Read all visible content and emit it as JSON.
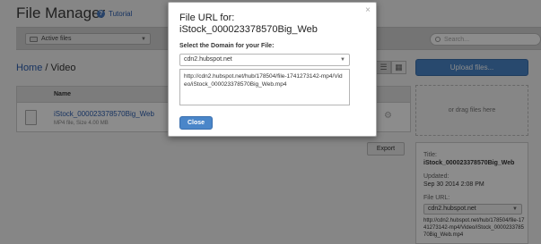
{
  "header": {
    "title": "File Manager",
    "tutorial_label": "Tutorial"
  },
  "toolbar": {
    "filter_label": "Active files",
    "search_placeholder": "Search..."
  },
  "breadcrumb": {
    "home": "Home",
    "separator": " / ",
    "current": "Video"
  },
  "actions": {
    "upload_label": "Upload files...",
    "dropzone_text": "or drag files here",
    "export_label": "Export"
  },
  "table": {
    "column_name": "Name",
    "rows": [
      {
        "name": "iStock_000023378570Big_Web",
        "meta": "MP4 file, Size 4.00 MB"
      }
    ]
  },
  "sidebar": {
    "title_label": "Title:",
    "title_value": "iStock_000023378570Big_Web",
    "updated_label": "Updated:",
    "updated_value": "Sep 30 2014 2:08 PM",
    "file_url_label": "File URL:",
    "domain_value": "cdn2.hubspot.net",
    "url_value": "http://cdn2.hubspot.net/hub/178504/file-1741273142-mp4/Video/iStock_000023378570Big_Web.mp4"
  },
  "modal": {
    "title": "File URL for: iStock_000023378570Big_Web",
    "domain_label": "Select the Domain for your File:",
    "domain_value": "cdn2.hubspot.net",
    "url_value": "http://cdn2.hubspot.net/hub/178504/file-1741273142-mp4/Video/iStock_000023378570Big_Web.mp4",
    "close_label": "Close",
    "close_x": "×"
  },
  "colors": {
    "accent": "#4a86c9",
    "link": "#2a5db0",
    "overlay": "#000000"
  }
}
